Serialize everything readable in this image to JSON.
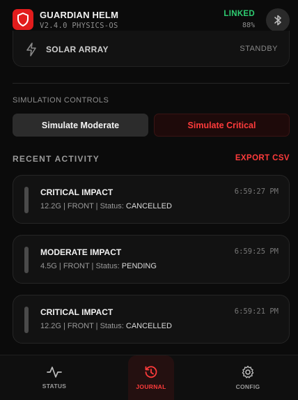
{
  "header": {
    "title": "GUARDIAN HELM",
    "version": "V2.4.0 PHYSICS-OS",
    "link_status": "LINKED",
    "battery": "88%",
    "link_color": "#2ecc71",
    "logo_icon": "shield-icon",
    "bluetooth_icon": "bluetooth-icon"
  },
  "solar": {
    "label": "SOLAR ARRAY",
    "status": "STANDBY",
    "icon": "lightning-icon"
  },
  "simulation": {
    "title": "SIMULATION CONTROLS",
    "moderate_label": "Simulate Moderate",
    "critical_label": "Simulate Critical"
  },
  "recent": {
    "title": "RECENT ACTIVITY",
    "export_label": "EXPORT CSV",
    "items": [
      {
        "title": "CRITICAL IMPACT",
        "time": "6:59:27 PM",
        "meta": "12.2G | FRONT | Status: ",
        "status": "CANCELLED"
      },
      {
        "title": "MODERATE IMPACT",
        "time": "6:59:25 PM",
        "meta": "4.5G | FRONT | Status: ",
        "status": "PENDING"
      },
      {
        "title": "CRITICAL IMPACT",
        "time": "6:59:21 PM",
        "meta": "12.2G | FRONT | Status: ",
        "status": "CANCELLED"
      }
    ]
  },
  "nav": {
    "items": [
      {
        "label": "STATUS",
        "icon": "activity-icon"
      },
      {
        "label": "JOURNAL",
        "icon": "history-icon",
        "active": true
      },
      {
        "label": "CONFIG",
        "icon": "gear-icon"
      }
    ]
  },
  "colors": {
    "accent_red": "#ff3b3b",
    "brand_red": "#e21c1c",
    "background": "#0b0b0b"
  }
}
